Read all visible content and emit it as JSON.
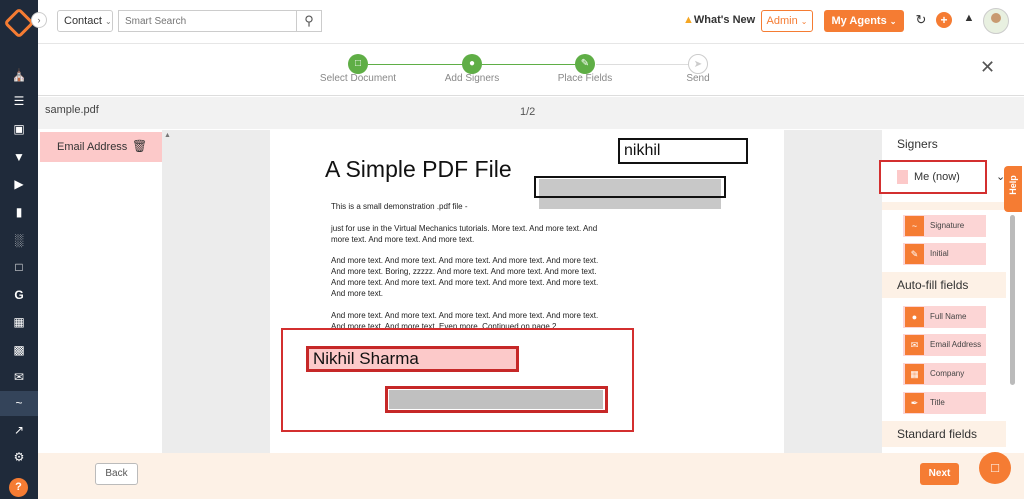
{
  "topbar": {
    "contact_label": "Contact",
    "search_placeholder": "Smart Search",
    "whats_new": "What's New",
    "admin_label": "Admin",
    "agents_label": "My Agents"
  },
  "steps": [
    {
      "label": "Select Document",
      "done": true
    },
    {
      "label": "Add Signers",
      "done": true
    },
    {
      "label": "Place Fields",
      "done": true
    },
    {
      "label": "Send",
      "done": false
    }
  ],
  "document": {
    "filename": "sample.pdf",
    "page_indicator": "1/2",
    "title": "A Simple PDF File",
    "paragraphs": [
      "This is a small demonstration .pdf file -",
      "just for use in the Virtual Mechanics tutorials. More text. And more text. And more text. And more text. And more text.",
      "And more text. And more text. And more text. And more text. And more text. And more text. Boring, zzzzz. And more text. And more text. And more text. And more text. And more text. And more text. And more text. And more text. And more text.",
      "And more text. And more text. And more text. And more text. And more text. And more text. And more text. Even more. Continued on page 2 ..."
    ],
    "placed_fields": {
      "name_top": "nikhil",
      "full_name": "Nikhil Sharma"
    }
  },
  "left_panel": {
    "selected_field": "Email Address"
  },
  "right_panel": {
    "signers_heading": "Signers",
    "signer_selected": "Me (now)",
    "signer_color": "#fcc9c9",
    "signer_fields": [
      "Signature",
      "Initial"
    ],
    "autofill_heading": "Auto-fill fields",
    "autofill_fields": [
      "Full Name",
      "Email Address",
      "Company",
      "Title"
    ],
    "standard_heading": "Standard fields"
  },
  "help_label": "Help",
  "footer": {
    "back_label": "Back",
    "next_label": "Next"
  },
  "colors": {
    "accent": "#f57c33",
    "step_done": "#5fae46",
    "sidebar": "#1f2a3a",
    "highlight_red": "#d32f2f"
  }
}
